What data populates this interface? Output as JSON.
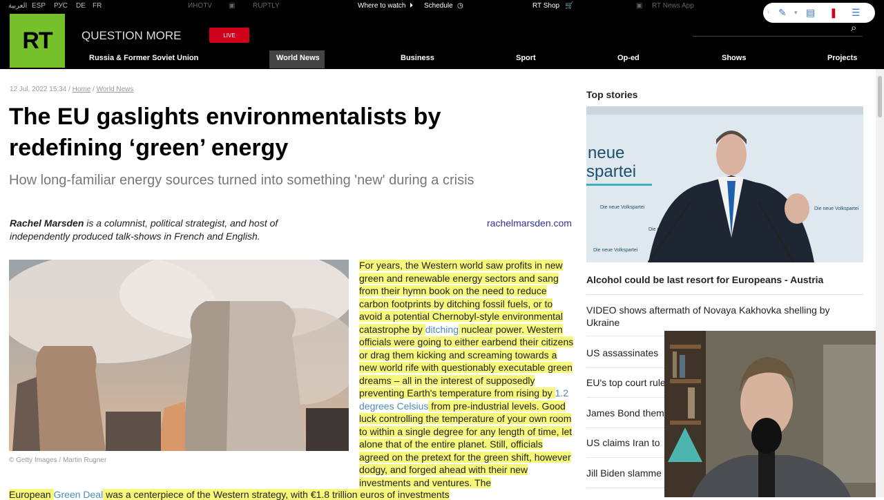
{
  "topbar": {
    "langs": [
      "العربية",
      "ESP",
      "РУС",
      "DE",
      "FR"
    ],
    "brands": [
      "ИНОTV",
      "RUPTLY"
    ],
    "where_to_watch": "Where to watch",
    "schedule": "Schedule",
    "shop": "RT Shop",
    "app": "RT News App"
  },
  "header": {
    "logo": "RT",
    "tagline": "QUESTION MORE",
    "live": "LIVE",
    "nav": [
      "Russia & Former Soviet Union",
      "World News",
      "Business",
      "Sport",
      "Op-ed",
      "Shows",
      "Projects"
    ],
    "active_nav": "World News"
  },
  "article": {
    "date": "12 Jul, 2022 15:34",
    "crumbs": [
      "Home",
      "World News"
    ],
    "title": "The EU gaslights environmentalists by redefining ‘green’ energy",
    "subtitle": "How long-familiar energy sources turned into something 'new' during a crisis",
    "author_name": "Rachel Marsden",
    "author_bio": " is a columnist, political strategist, and host of independently produced talk-shows in French and English.",
    "author_link": "rachelmarsden.com",
    "photo_credit": "© Getty Images / Martin Rugner",
    "body_p1": "For years, the Western world saw profits in new green and renewable energy sectors and sang from their hymn book on the need to reduce carbon footprints by ditching fossil fuels, or to avoid a potential Chernobyl-style environmental catastrophe by ",
    "body_link1": "ditching",
    "body_p2": " nuclear power. Western officials were going to either earbend their citizens or drag them kicking and screaming towards a new world rife with questionably executable green dreams – all in the interest of supposedly preventing Earth's temperature from rising by ",
    "body_link2": "1.2 degrees Celsius",
    "body_p3": " from pre-industrial levels. Good luck controlling the temperature of your own room to within a single degree for any length of time, let alone that of the entire planet. Still, officials agreed on the pretext for the green shift, however dodgy, and forged ahead with their new investments and ventures. The",
    "bottom_a": "European ",
    "bottom_link": "Green Deal",
    "bottom_b": " was a centerpiece of the Western strategy, with €1.8 trillion euros of investments"
  },
  "sidebar": {
    "heading": "Top stories",
    "stories": [
      "Alcohol could be last resort for Europeans - Austria",
      "VIDEO shows aftermath of Novaya Kakhovka shelling by Ukraine",
      "US assassinates",
      "EU's top court rule",
      "James Bond them",
      "US claims Iran to",
      "Jill Biden slamme"
    ],
    "photo_text": [
      "neue",
      "spartei",
      "Die neue Volkspartei"
    ]
  }
}
